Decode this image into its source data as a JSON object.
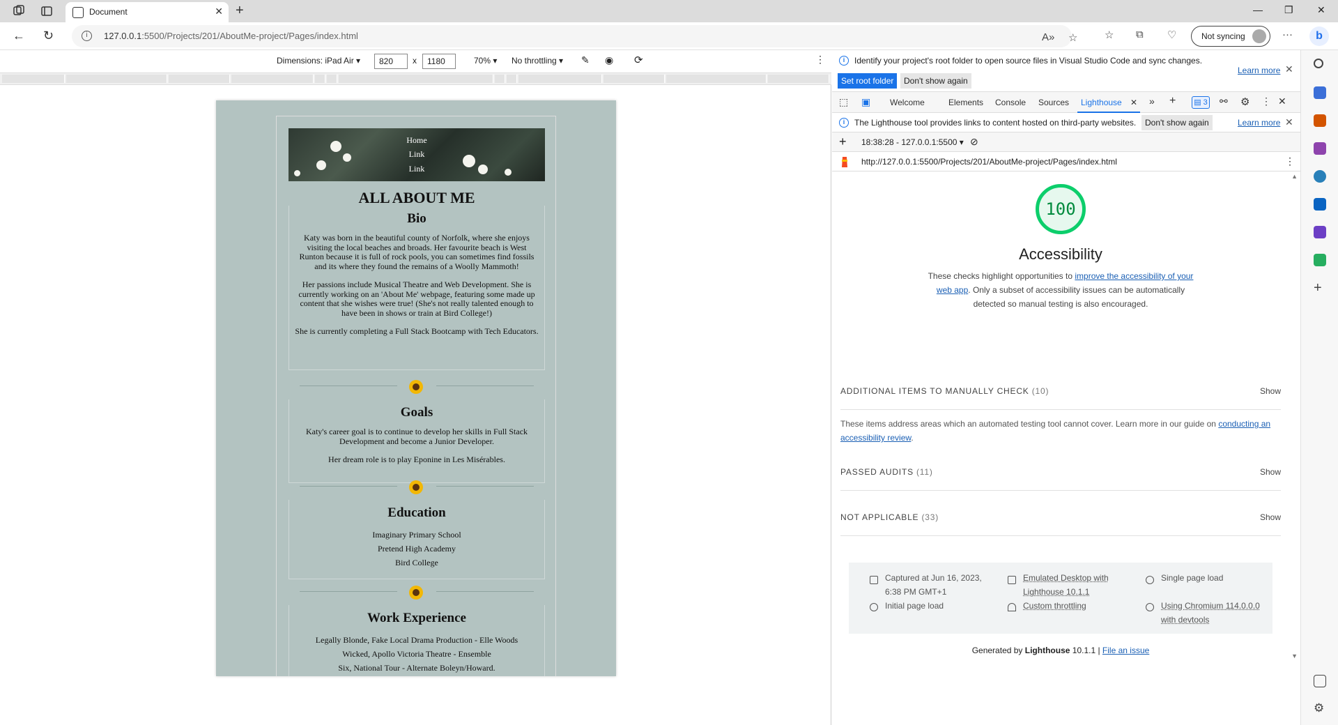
{
  "browser": {
    "tab_title": "Document",
    "url_prefix": "127.0.0.1",
    "url_rest": ":5500/Projects/201/AboutMe-project/Pages/index.html",
    "sync_label": "Not syncing"
  },
  "device_toolbar": {
    "dimensions_label": "Dimensions: iPad Air",
    "width": "820",
    "times": "x",
    "height": "1180",
    "zoom": "70%",
    "throttling": "No throttling"
  },
  "site": {
    "nav_links": [
      "Home",
      "Link",
      "Link"
    ],
    "title": "ALL ABOUT ME",
    "bio": {
      "heading": "Bio",
      "paragraphs": [
        "Katy was born in the beautiful county of Norfolk, where she enjoys visiting the local beaches and broads. Her favourite beach is West Runton because it is full of rock pools, you can sometimes find fossils and its where they found the remains of a Woolly Mammoth!",
        "Her passions include Musical Theatre and Web Development. She is currently working on an 'About Me' webpage, featuring some made up content that she wishes were true! (She's not really talented enough to have been in shows or train at Bird College!)",
        "She is currently completing a Full Stack Bootcamp with Tech Educators."
      ]
    },
    "goals": {
      "heading": "Goals",
      "paragraphs": [
        "Katy's career goal is to continue to develop her skills in Full Stack Development and become a Junior Developer.",
        "Her dream role is to play Eponine in Les Misérables."
      ]
    },
    "education": {
      "heading": "Education",
      "items": [
        "Imaginary Primary School",
        "Pretend High Academy",
        "Bird College"
      ]
    },
    "work": {
      "heading": "Work Experience",
      "items": [
        "Legally Blonde, Fake Local Drama Production - Elle Woods",
        "Wicked, Apollo Victoria Theatre - Ensemble",
        "Six, National Tour - Alternate Boleyn/Howard."
      ]
    }
  },
  "devtools": {
    "info_banner": "Identify your project's root folder to open source files in Visual Studio Code and sync changes.",
    "learn_more": "Learn more",
    "set_root_folder": "Set root folder",
    "dont_show_again": "Don't show again",
    "tabs": [
      "Welcome",
      "Elements",
      "Console",
      "Sources",
      "Lighthouse"
    ],
    "issues_count": "3",
    "lighthouse_notice": "The Lighthouse tool provides links to content hosted on third-party websites.",
    "run_label": "18:38:28 - 127.0.0.1:5500",
    "report_url": "http://127.0.0.1:5500/Projects/201/AboutMe-project/Pages/index.html",
    "score": "100",
    "category": "Accessibility",
    "desc_pre": "These checks highlight opportunities to ",
    "desc_link": "improve the accessibility of your web app",
    "desc_post": ". Only a subset of accessibility issues can be automatically detected so manual testing is also encouraged.",
    "groups": [
      {
        "title": "ADDITIONAL ITEMS TO MANUALLY CHECK",
        "count": "(10)",
        "action": "Show"
      },
      {
        "title": "PASSED AUDITS",
        "count": "(11)",
        "action": "Show"
      },
      {
        "title": "NOT APPLICABLE",
        "count": "(33)",
        "action": "Show"
      }
    ],
    "manual_desc_pre": "These items address areas which an automated testing tool cannot cover. Learn more in our guide on ",
    "manual_desc_link": "conducting an accessibility review",
    "manual_desc_post": ".",
    "runtime": {
      "captured": "Captured at Jun 16, 2023, 6:38 PM GMT+1",
      "initial_load": "Initial page load",
      "emulated": "Emulated Desktop with Lighthouse 10.1.1",
      "throttling": "Custom throttling",
      "single_load": "Single page load",
      "chromium": "Using Chromium 114.0.0.0 with devtools"
    },
    "footer_pre": "Generated by ",
    "footer_brand": "Lighthouse",
    "footer_version": " 10.1.1 | ",
    "footer_link": "File an issue"
  },
  "colors": {
    "accent": "#1a73e8",
    "score_green": "#0cce6b",
    "page_bg": "#b3c3c1"
  }
}
